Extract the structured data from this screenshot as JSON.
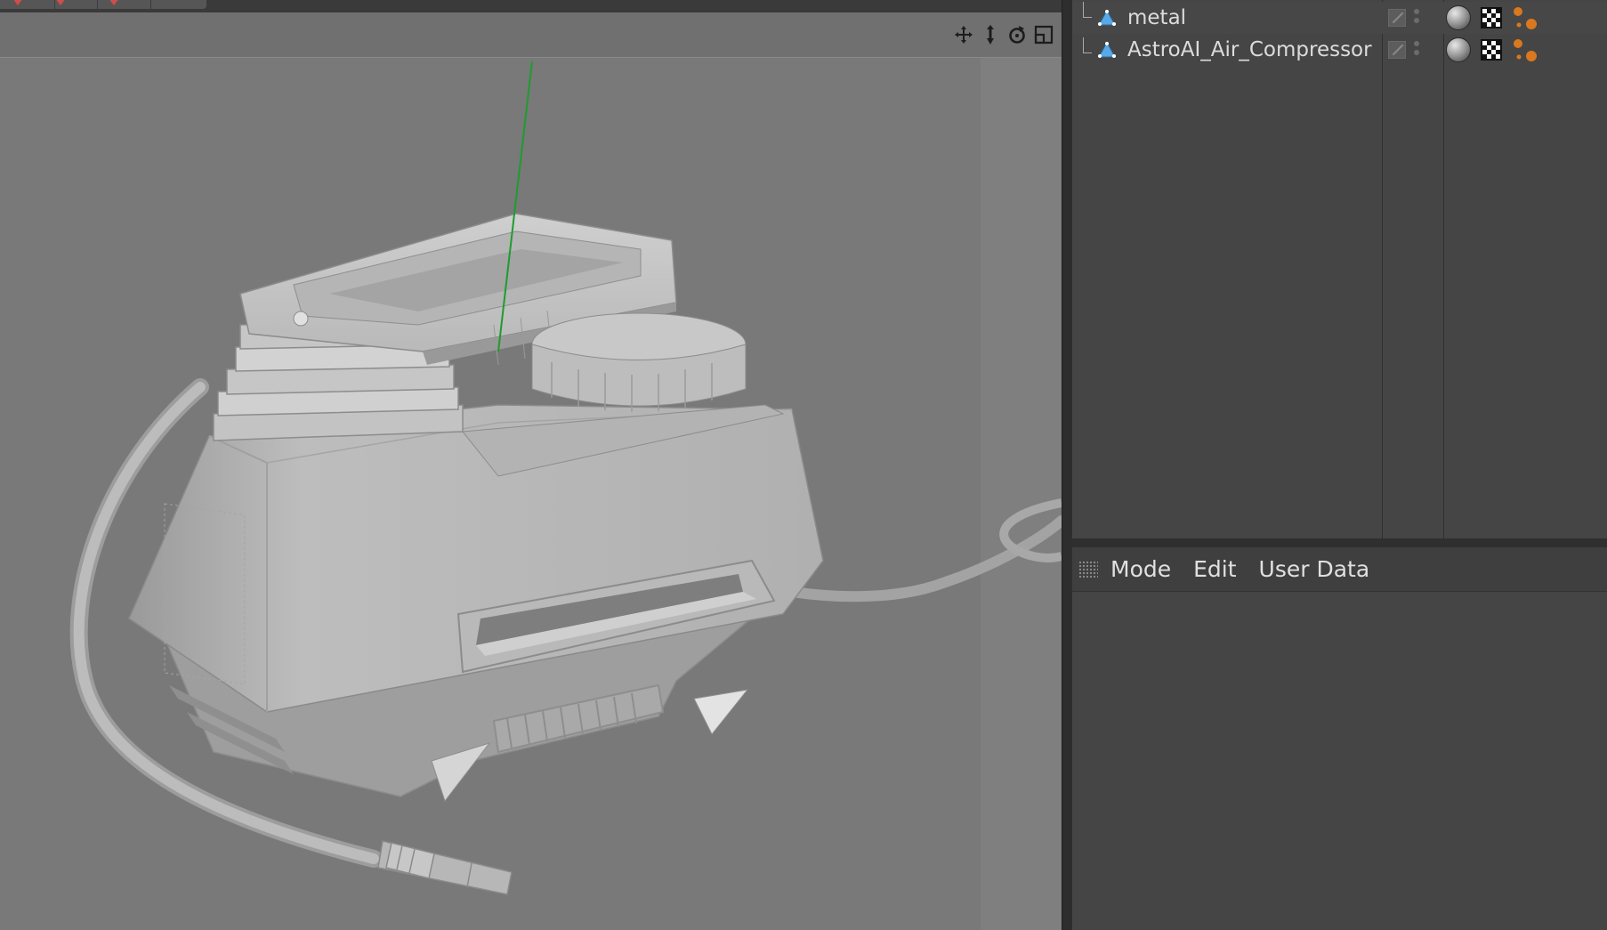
{
  "objects": {
    "items": [
      {
        "name": "metal",
        "type_icon": "polygon-object-icon",
        "tags": [
          "material-sphere-icon",
          "checker-texture-icon",
          "node-tag-icon"
        ]
      },
      {
        "name": "AstroAI_Air_Compressor",
        "type_icon": "polygon-object-icon",
        "tags": [
          "material-sphere-icon",
          "checker-texture-icon",
          "node-tag-icon"
        ]
      }
    ]
  },
  "attributes": {
    "menu": [
      "Mode",
      "Edit",
      "User Data"
    ]
  },
  "viewport": {
    "nav_icons": [
      "move-view-icon",
      "zoom-view-icon",
      "rotate-view-icon",
      "maximize-view-icon"
    ]
  },
  "colors": {
    "viewport_bg": "#797979",
    "panel_bg": "#454545",
    "axis_green": "#1e9c2e",
    "accent_red": "#d24c4c",
    "tag_orange": "#d9781e",
    "object_icon_blue": "#5aa9e6"
  }
}
